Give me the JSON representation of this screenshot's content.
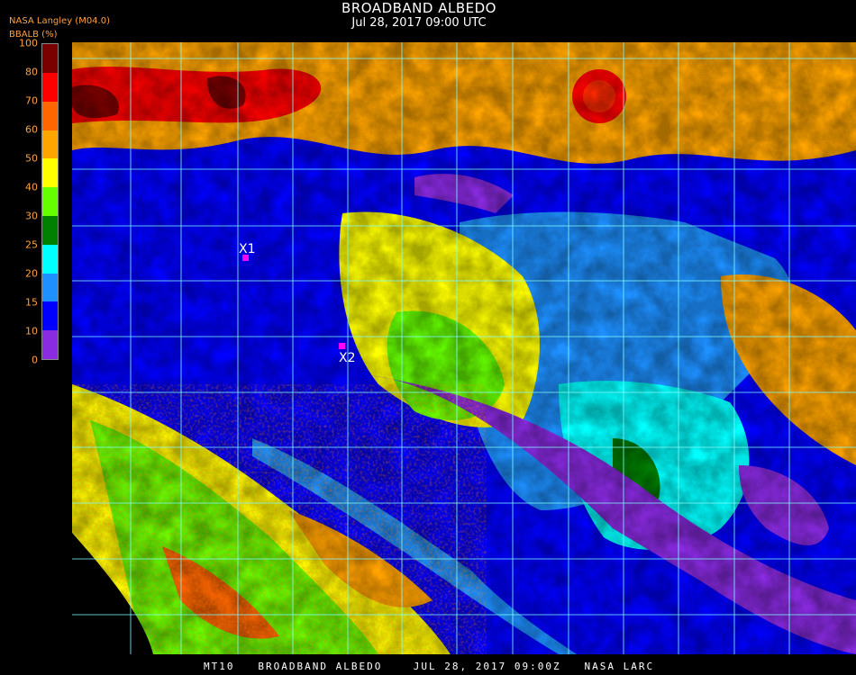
{
  "header": {
    "title": "BROADBAND ALBEDO",
    "subtitle": "Jul 28, 2017 09:00 UTC"
  },
  "source_label": "NASA Langley (M04.0)",
  "units_label": "BBALB (%)",
  "legend": {
    "ticks": [
      "0",
      "10",
      "15",
      "20",
      "25",
      "30",
      "40",
      "50",
      "60",
      "70",
      "80",
      "100"
    ],
    "colors": [
      "#8a2be2",
      "#0000ff",
      "#1e90ff",
      "#00ffff",
      "#008000",
      "#66ff00",
      "#ffff00",
      "#ffa500",
      "#ff6600",
      "#ff0000",
      "#7a0000"
    ]
  },
  "markers": [
    {
      "label": "X1",
      "color": "#ff00ff"
    },
    {
      "label": "X2",
      "color": "#ff00ff"
    }
  ],
  "footer": "MT10   BROADBAND ALBEDO    JUL 28, 2017 09:00Z   NASA LARC",
  "grid_color": "#7fffff"
}
